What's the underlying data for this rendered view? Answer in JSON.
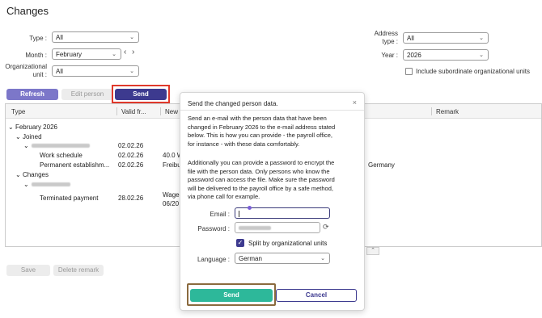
{
  "page_title": "Changes",
  "filters": {
    "type": {
      "label": "Type :",
      "value": "All"
    },
    "month": {
      "label": "Month :",
      "value": "February"
    },
    "org_unit": {
      "label_line1": "Organizational",
      "label_line2": "unit :",
      "value": "All"
    },
    "address_type": {
      "label_line1": "Address",
      "label_line2": "type :",
      "value": "All"
    },
    "year": {
      "label": "Year :",
      "value": "2026"
    },
    "include_subordinate": {
      "label": "Include subordinate organizational units",
      "checked": false
    }
  },
  "toolbar": {
    "refresh": "Refresh",
    "edit_person": "Edit person",
    "send": "Send"
  },
  "table": {
    "columns": [
      "Type",
      "Valid fr...",
      "New",
      "Remark"
    ],
    "group": "February 2026",
    "sub_joined": "Joined",
    "sub_changes": "Changes",
    "rows": [
      {
        "type": "Work schedule",
        "valid": "02.02.26",
        "new": "40.0 W"
      },
      {
        "type": "Permanent establishm...",
        "valid": "02.02.26",
        "new": "Freibu",
        "extra": "Germany"
      },
      {
        "type": "Terminated payment",
        "valid": "28.02.26",
        "new_line1": "Wage",
        "new_line2": "06/20"
      }
    ],
    "person_row_joined_date": "02.02.26"
  },
  "bottom_buttons": {
    "save": "Save",
    "delete_remark": "Delete remark"
  },
  "modal": {
    "title": "Send the changed person data.",
    "close": "×",
    "para1_lines": [
      "Send an e-mail with the person data that have been",
      "changed in February 2026 to the e-mail address stated",
      "below. This is how you can provide - the payroll office,",
      "for instance - with these data comfortably."
    ],
    "para2_lines": [
      "Additionally you can provide a password to encrypt the",
      "file with the person data. Only persons who know the",
      "password can access the file. Make sure the password",
      "will be delivered to the payroll office by a safe method,",
      "via phone call for example."
    ],
    "email_label": "Email :",
    "password_label": "Password :",
    "split_label": "Split by organizational units",
    "split_checked": true,
    "language_label": "Language :",
    "language_value": "German",
    "send": "Send",
    "cancel": "Cancel"
  },
  "colors": {
    "accent": "#3d3a8f",
    "refresh": "#7c77c9",
    "send_modal": "#2db89a",
    "highlight_red": "#e0392b",
    "highlight_brown": "#8a6a3e"
  }
}
